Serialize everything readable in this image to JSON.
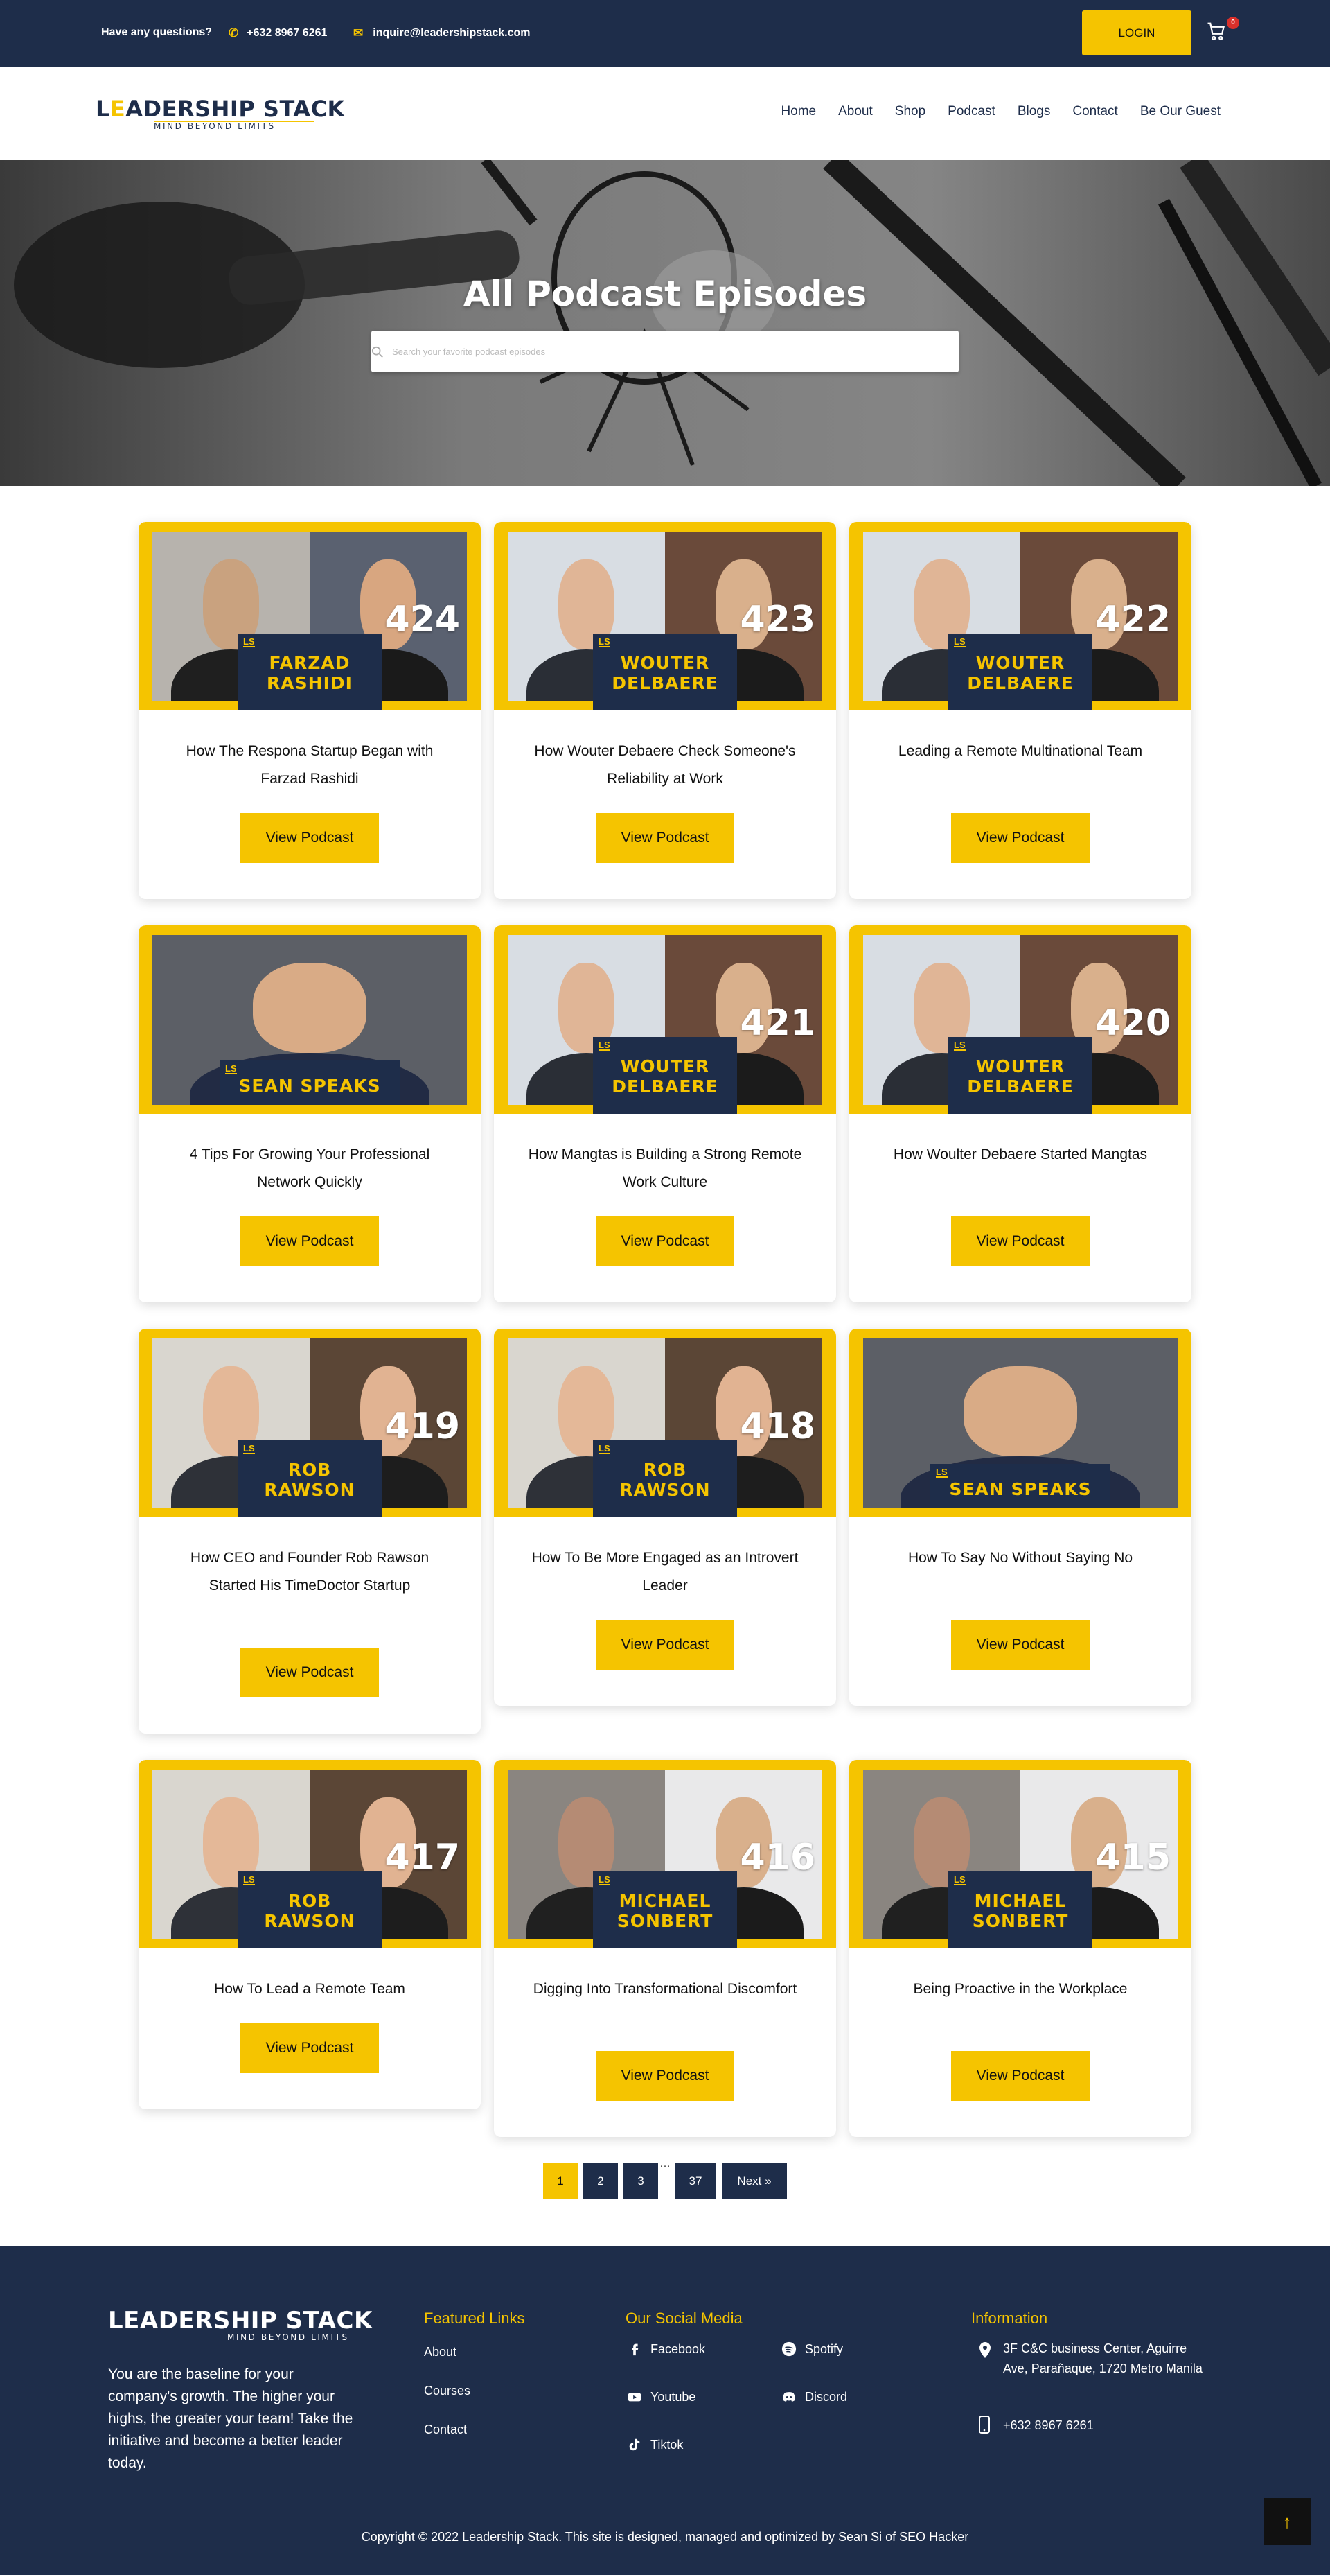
{
  "topbar": {
    "question": "Have any questions?",
    "phone": "+632 8967 6261",
    "email": "inquire@leadershipstack.com",
    "login_label": "LOGIN",
    "cart_count": "0"
  },
  "brand": {
    "name": "LEADERSHIP STACK",
    "name_pre": "L",
    "name_a": "E",
    "name_post": "ADERSHIP STACK",
    "tagline": "MIND BEYOND LIMITS"
  },
  "nav": {
    "items": [
      "Home",
      "About",
      "Shop",
      "Podcast",
      "Blogs",
      "Contact",
      "Be Our Guest"
    ]
  },
  "hero": {
    "title": "All Podcast Episodes",
    "search_placeholder": "Search your favorite podcast episodes"
  },
  "episodes": [
    {
      "number": "424",
      "guest_line1": "FARZAD",
      "guest_line2": "RASHIDI",
      "title": "How The Respona Startup Began with Farzad Rashidi",
      "button": "View Podcast"
    },
    {
      "number": "423",
      "guest_line1": "WOUTER",
      "guest_line2": "DELBAERE",
      "title": "How Wouter Debaere Check Someone's Reliability at Work",
      "button": "View Podcast"
    },
    {
      "number": "422",
      "guest_line1": "WOUTER",
      "guest_line2": "DELBAERE",
      "title": "Leading a Remote Multinational Team",
      "button": "View Podcast"
    },
    {
      "number": "",
      "guest_line1": "SEAN SPEAKS",
      "guest_line2": "",
      "title": "4 Tips For Growing Your Professional Network Quickly",
      "button": "View Podcast"
    },
    {
      "number": "421",
      "guest_line1": "WOUTER",
      "guest_line2": "DELBAERE",
      "title": "How Mangtas is Building a Strong Remote Work Culture",
      "button": "View Podcast"
    },
    {
      "number": "420",
      "guest_line1": "WOUTER",
      "guest_line2": "DELBAERE",
      "title": "How Woulter Debaere Started Mangtas",
      "button": "View Podcast"
    },
    {
      "number": "419",
      "guest_line1": "ROB",
      "guest_line2": "RAWSON",
      "title": "How CEO and Founder Rob Rawson Started His TimeDoctor Startup",
      "button": "View Podcast"
    },
    {
      "number": "418",
      "guest_line1": "ROB",
      "guest_line2": "RAWSON",
      "title": "How To Be More Engaged as an Introvert Leader",
      "button": "View Podcast"
    },
    {
      "number": "",
      "guest_line1": "SEAN SPEAKS",
      "guest_line2": "",
      "title": "How To Say No Without Saying No",
      "button": "View Podcast"
    },
    {
      "number": "417",
      "guest_line1": "ROB",
      "guest_line2": "RAWSON",
      "title": "How To Lead a Remote Team",
      "button": "View Podcast"
    },
    {
      "number": "416",
      "guest_line1": "MICHAEL",
      "guest_line2": "SONBERT",
      "title": "Digging Into Transformational Discomfort",
      "button": "View Podcast"
    },
    {
      "number": "415",
      "guest_line1": "MICHAEL",
      "guest_line2": "SONBERT",
      "title": "Being Proactive in the Workplace",
      "button": "View Podcast"
    }
  ],
  "badge_logo": "LS",
  "pagination": {
    "pages": [
      "1",
      "2",
      "3",
      "37"
    ],
    "ellipsis": "…",
    "next": "Next »",
    "current": "1"
  },
  "footer": {
    "about": "You are the baseline for your company's growth. The higher your highs, the greater your team! Take the initiative and become a better leader today.",
    "featured_heading": "Featured Links",
    "featured_links": [
      "About",
      "Courses",
      "Contact"
    ],
    "social_heading": "Our Social Media",
    "social": [
      "Facebook",
      "Spotify",
      "Youtube",
      "Discord",
      "Tiktok"
    ],
    "info_heading": "Information",
    "address": "3F C&C business Center, Aguirre Ave, Parañaque, 1720 Metro Manila",
    "phone": "+632 8967 6261",
    "copyright": "Copyright © 2022 Leadership Stack. This site is designed, managed and optimized by Sean Si of SEO Hacker"
  },
  "colors": {
    "navy": "#1e2d4a",
    "yellow": "#f5c400",
    "badge_red": "#d9302b"
  },
  "icons": [
    "phone-icon",
    "mail-icon",
    "cart-icon",
    "search-icon",
    "facebook-icon",
    "spotify-icon",
    "youtube-icon",
    "discord-icon",
    "tiktok-icon",
    "location-icon",
    "mobile-icon",
    "arrow-up-icon"
  ]
}
